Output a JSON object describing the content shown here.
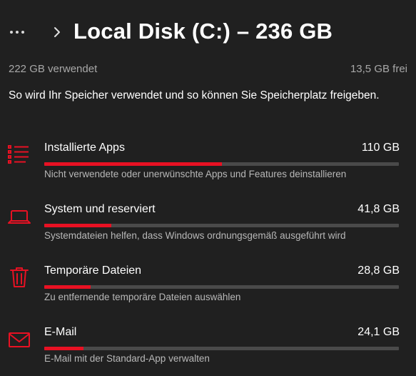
{
  "header": {
    "title": "Local Disk (C:) – 236 GB",
    "more_icon": "more-dots-icon",
    "breadcrumb_icon": "chevron-right-icon"
  },
  "summary": {
    "used": "222 GB verwendet",
    "free": "13,5 GB frei"
  },
  "description": "So wird Ihr Speicher verwendet und so können Sie Speicherplatz freigeben.",
  "accent_color": "#e81123",
  "categories": [
    {
      "icon": "apps-list-icon",
      "name": "Installierte Apps",
      "size": "110 GB",
      "usage_fraction": 0.5,
      "subtitle": "Nicht verwendete oder unerwünschte Apps und Features deinstallieren"
    },
    {
      "icon": "laptop-icon",
      "name": "System und reserviert",
      "size": "41,8 GB",
      "usage_fraction": 0.19,
      "subtitle": "Systemdateien helfen, dass Windows ordnungsgemäß ausgeführt wird"
    },
    {
      "icon": "trash-icon",
      "name": "Temporäre Dateien",
      "size": "28,8 GB",
      "usage_fraction": 0.13,
      "subtitle": "Zu entfernende temporäre Dateien auswählen"
    },
    {
      "icon": "mail-icon",
      "name": "E-Mail",
      "size": "24,1 GB",
      "usage_fraction": 0.11,
      "subtitle": "E-Mail mit der Standard-App verwalten"
    }
  ]
}
